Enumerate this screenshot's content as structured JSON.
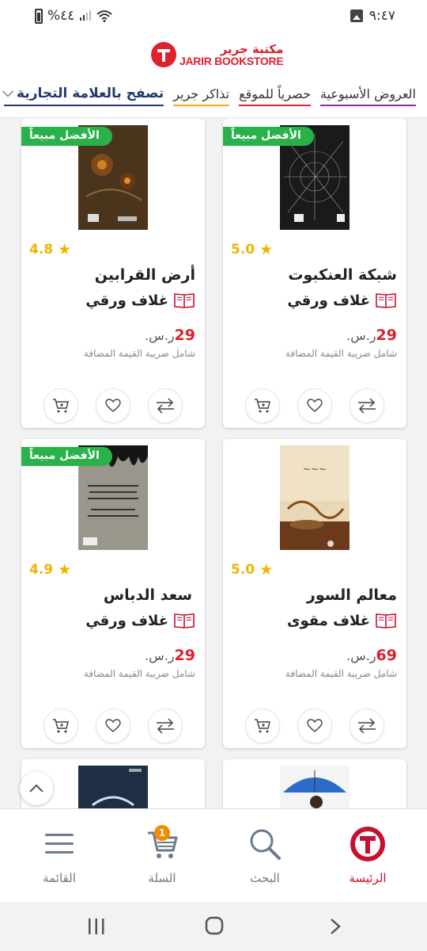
{
  "status_bar": {
    "battery": "%٤٤",
    "time": "٩:٤٧"
  },
  "header": {
    "logo_ar": "مكتبة جرير",
    "logo_en": "JARIR BOOKSTORE"
  },
  "nav": {
    "items": [
      "تصفح بالعلامة التجارية",
      "تذاكر جرير",
      "حصرياً للموقع",
      "العروض الأسبوعية"
    ],
    "underline_colors": [
      "#1f3a6e",
      "#f4a81d",
      "#e0202b",
      "#8a2a9c"
    ]
  },
  "badge_label": "الأفضل مبيعاً",
  "vat_note": "شامل ضريبة القيمة المضافة",
  "currency": "ر.س.",
  "products": [
    {
      "title": "شبكة العنكبوت",
      "format": "غلاف ورقي",
      "price": "29",
      "rating": "5.0",
      "bestseller": true
    },
    {
      "title": "أرض القرابين",
      "format": "غلاف ورقي",
      "price": "29",
      "rating": "4.8",
      "bestseller": true
    },
    {
      "title": "معالم السور",
      "format": "غلاف مقوى",
      "price": "69",
      "rating": "5.0",
      "bestseller": false
    },
    {
      "title": "سعد الدباس",
      "format": "غلاف ورقي",
      "price": "29",
      "rating": "4.9",
      "bestseller": true
    }
  ],
  "bottom_nav": {
    "home": "الرئيسة",
    "search": "البحث",
    "cart": "السلة",
    "cart_count": "1",
    "menu": "القائمة"
  },
  "colors": {
    "brand_red": "#e0202b",
    "bestseller_green": "#2ab24a",
    "rating_gold": "#f0b400",
    "cart_badge": "#f08c00"
  }
}
